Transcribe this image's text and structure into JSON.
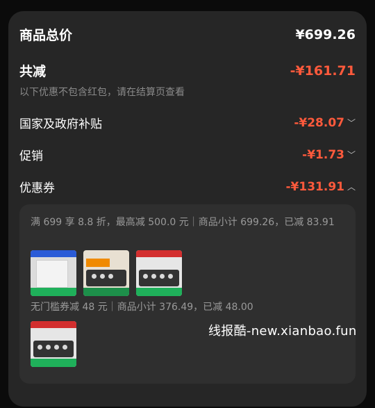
{
  "summary": {
    "total_label": "商品总价",
    "total_value": "¥699.26",
    "reduce_label": "共减",
    "reduce_value": "-¥161.71",
    "note": "以下优惠不包含红包，请在结算页查看"
  },
  "discounts": [
    {
      "label": "国家及政府补贴",
      "value": "-¥28.07",
      "chevron": "chevron-down"
    },
    {
      "label": "促销",
      "value": "-¥1.73",
      "chevron": "chevron-down"
    },
    {
      "label": "优惠券",
      "value": "-¥131.91",
      "chevron": "chevron-up"
    }
  ],
  "coupon_details": [
    {
      "rule": "满 699 享 8.8 折，最高减 500.0 元｜商品小计 699.26，已减 83.91",
      "thumbs": 3
    },
    {
      "rule": "无门槛券减 48 元｜商品小计 376.49，已减 48.00",
      "thumbs": 1
    }
  ],
  "colors": {
    "accent_red": "#ff5a3c",
    "panel": "#262626",
    "inner": "#2f2f2f"
  },
  "watermark": "线报酷-new.xianbao.fun"
}
